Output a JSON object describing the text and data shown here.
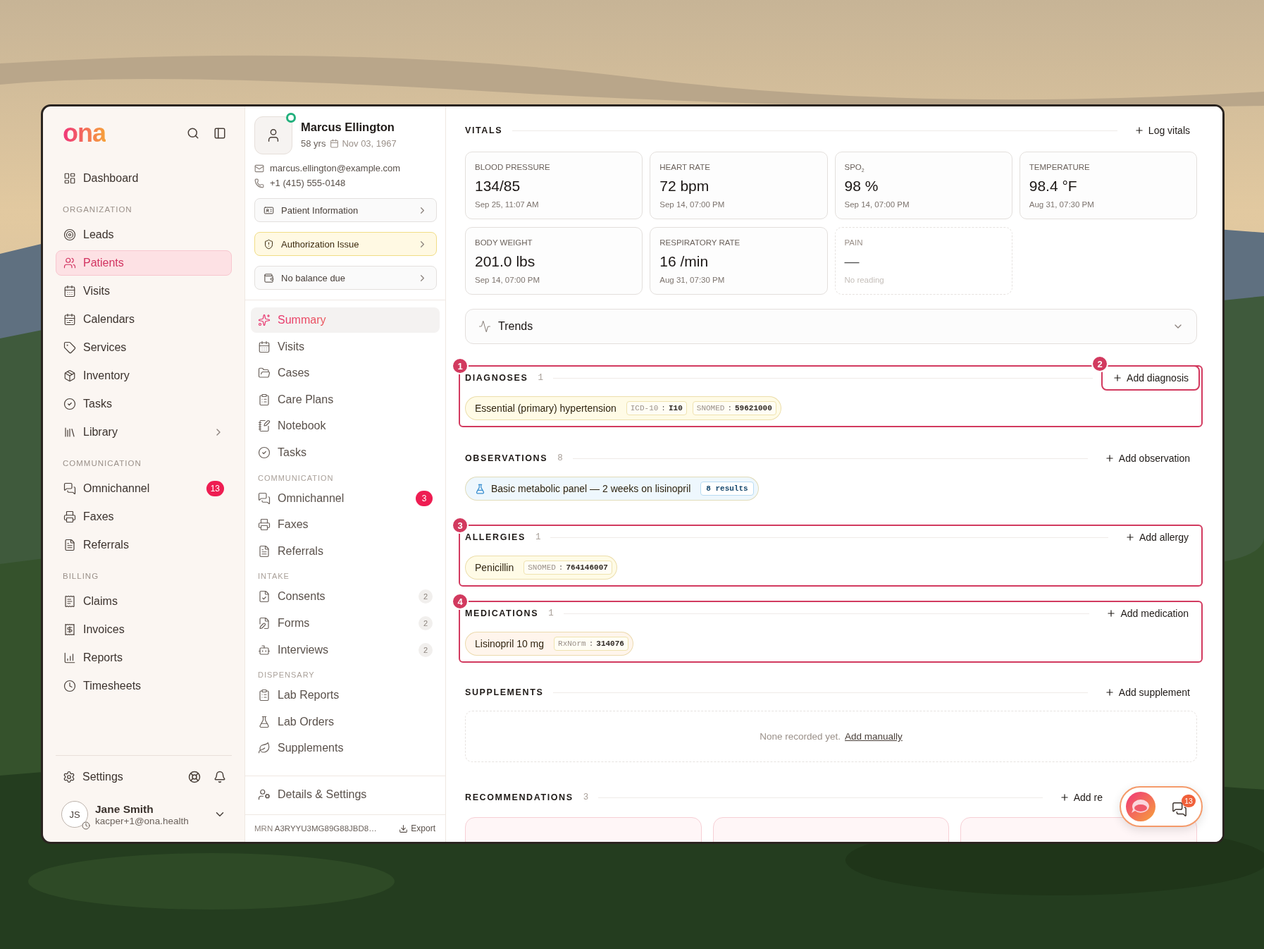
{
  "sidebar": {
    "logo": "ona",
    "nav": [
      {
        "kind": "item",
        "label": "Dashboard",
        "selected": false
      },
      {
        "kind": "heading",
        "label": "ORGANIZATION"
      },
      {
        "kind": "item",
        "label": "Leads",
        "selected": false
      },
      {
        "kind": "item",
        "label": "Patients",
        "selected": true
      },
      {
        "kind": "item",
        "label": "Visits",
        "selected": false
      },
      {
        "kind": "item",
        "label": "Calendars",
        "selected": false
      },
      {
        "kind": "item",
        "label": "Services",
        "selected": false
      },
      {
        "kind": "item",
        "label": "Inventory",
        "selected": false
      },
      {
        "kind": "item",
        "label": "Tasks",
        "selected": false
      },
      {
        "kind": "item",
        "label": "Library",
        "selected": false,
        "submenu": true
      },
      {
        "kind": "heading",
        "label": "COMMUNICATION"
      },
      {
        "kind": "item",
        "label": "Omnichannel",
        "selected": false,
        "badge": "13"
      },
      {
        "kind": "item",
        "label": "Faxes",
        "selected": false
      },
      {
        "kind": "item",
        "label": "Referrals",
        "selected": false
      },
      {
        "kind": "heading",
        "label": "BILLING"
      },
      {
        "kind": "item",
        "label": "Claims",
        "selected": false
      },
      {
        "kind": "item",
        "label": "Invoices",
        "selected": false
      },
      {
        "kind": "item",
        "label": "Reports",
        "selected": false
      },
      {
        "kind": "item",
        "label": "Timesheets",
        "selected": false
      }
    ],
    "settings": "Settings",
    "user": {
      "initials": "JS",
      "name": "Jane Smith",
      "email": "kacper+1@ona.health"
    }
  },
  "patient": {
    "name": "Marcus Ellington",
    "online": true,
    "age": "58 yrs",
    "dob": "Nov 03, 1967",
    "email": "marcus.ellington@example.com",
    "phone": "+1 (415) 555-0148",
    "actions": [
      {
        "label": "Patient Information",
        "kind": "neutral"
      },
      {
        "label": "Authorization Issue",
        "kind": "warning"
      },
      {
        "label": "No balance due",
        "kind": "neutral"
      }
    ],
    "nav": [
      {
        "kind": "item",
        "label": "Summary",
        "selected": true
      },
      {
        "kind": "item",
        "label": "Visits",
        "selected": false
      },
      {
        "kind": "item",
        "label": "Cases",
        "selected": false
      },
      {
        "kind": "item",
        "label": "Care Plans",
        "selected": false
      },
      {
        "kind": "item",
        "label": "Notebook",
        "selected": false
      },
      {
        "kind": "item",
        "label": "Tasks",
        "selected": false
      },
      {
        "kind": "heading",
        "label": "COMMUNICATION"
      },
      {
        "kind": "item",
        "label": "Omnichannel",
        "selected": false,
        "badge": {
          "label": "3",
          "kind": "alert"
        }
      },
      {
        "kind": "item",
        "label": "Faxes",
        "selected": false
      },
      {
        "kind": "item",
        "label": "Referrals",
        "selected": false
      },
      {
        "kind": "heading",
        "label": "INTAKE"
      },
      {
        "kind": "item",
        "label": "Consents",
        "selected": false,
        "badge": {
          "label": "2",
          "kind": "count"
        }
      },
      {
        "kind": "item",
        "label": "Forms",
        "selected": false,
        "badge": {
          "label": "2",
          "kind": "count"
        }
      },
      {
        "kind": "item",
        "label": "Interviews",
        "selected": false,
        "badge": {
          "label": "2",
          "kind": "count"
        }
      },
      {
        "kind": "heading",
        "label": "DISPENSARY"
      },
      {
        "kind": "item",
        "label": "Lab Reports",
        "selected": false
      },
      {
        "kind": "item",
        "label": "Lab Orders",
        "selected": false
      },
      {
        "kind": "item",
        "label": "Supplements",
        "selected": false
      }
    ],
    "details": "Details & Settings",
    "mrn_label": "MRN",
    "mrn": "A3RYYU3MG89G88JBD8…",
    "export": "Export"
  },
  "vitals": {
    "title": "VITALS",
    "action": "Log vitals",
    "cards": [
      {
        "label": "BLOOD PRESSURE",
        "value": "134/85",
        "time": "Sep 25, 11:07 AM",
        "empty": false
      },
      {
        "label": "HEART RATE",
        "value": "72 bpm",
        "time": "Sep 14, 07:00 PM",
        "empty": false
      },
      {
        "label": "SPO$_{2}$",
        "value": "98 %",
        "time": "Sep 14, 07:00 PM",
        "empty": false
      },
      {
        "label": "TEMPERATURE",
        "value": "98.4 °F",
        "time": "Aug 31, 07:30 PM",
        "empty": false
      },
      {
        "label": "BODY WEIGHT",
        "value": "201.0 lbs",
        "time": "Sep 14, 07:00 PM",
        "empty": false
      },
      {
        "label": "RESPIRATORY RATE",
        "value": "16 /min",
        "time": "Aug 31, 07:30 PM",
        "empty": false
      },
      {
        "label": "PAIN",
        "value": "—",
        "time": "No reading",
        "empty": true
      }
    ],
    "trends": {
      "label": "Trends",
      "expanded": false
    }
  },
  "sections": [
    {
      "kind": "chips",
      "title": "DIAGNOSES",
      "count": "1",
      "action": "Add diagnosis",
      "callout": "1",
      "action_callout": "2",
      "items": [
        {
          "label": "Essential (primary) hypertension",
          "color": "#fffbe6",
          "codes": [
            {
              "system": "ICD-10",
              "separator": ":",
              "code": "I10"
            },
            {
              "system": "SNOMED",
              "separator": ":",
              "code": "59621000"
            }
          ]
        }
      ]
    },
    {
      "kind": "chips",
      "title": "OBSERVATIONS",
      "count": "8",
      "action": "Add observation",
      "items": [
        {
          "label": "Basic metabolic panel — 2 weeks on lisinopril",
          "color": "#eef7fd",
          "results": "8 results"
        }
      ]
    },
    {
      "kind": "chips",
      "title": "ALLERGIES",
      "count": "1",
      "action": "Add allergy",
      "callout": "3",
      "items": [
        {
          "label": "Penicillin",
          "color": "#fffbe6",
          "codes": [
            {
              "system": "SNOMED",
              "separator": ":",
              "code": "764146007"
            }
          ]
        }
      ]
    },
    {
      "kind": "chips",
      "title": "MEDICATIONS",
      "count": "1",
      "action": "Add medication",
      "callout": "4",
      "items": [
        {
          "label": "Lisinopril 10 mg",
          "color": "#fff5ec",
          "codes": [
            {
              "system": "RxNorm",
              "separator": ":",
              "code": "314076"
            }
          ]
        }
      ]
    },
    {
      "kind": "empty",
      "title": "SUPPLEMENTS",
      "action": "Add supplement",
      "empty_text": "None recorded yet.",
      "link": "Add manually"
    },
    {
      "kind": "cards",
      "title": "RECOMMENDATIONS",
      "count": "3",
      "action": "Add re",
      "items": [
        {
          "kind": "card"
        },
        {
          "kind": "card"
        },
        {
          "kind": "card"
        }
      ]
    }
  ],
  "widget": {
    "badge": "13"
  }
}
